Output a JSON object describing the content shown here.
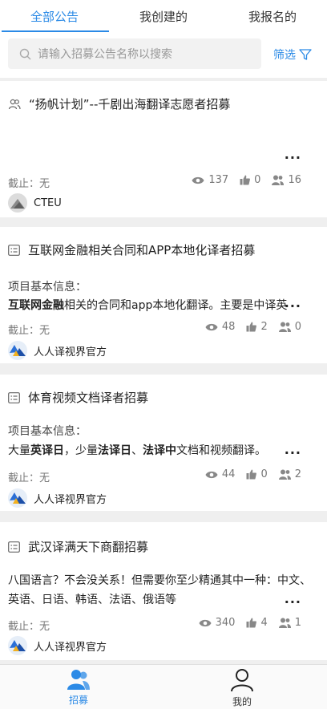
{
  "tabs": [
    "全部公告",
    "我创建的",
    "我报名的"
  ],
  "search": {
    "placeholder": "请输入招募公告名称以搜索",
    "filter_label": "筛选"
  },
  "cards": [
    {
      "title": "“扬帆计划”--千剧出海翻译志愿者招募",
      "deadline": "截止：无",
      "views": "137",
      "likes": "0",
      "applicants": "16",
      "publisher": "CTEU",
      "more": "..."
    },
    {
      "title": "互联网金融相关合同和APP本地化译者招募",
      "desc_label": "项目基本信息：",
      "desc_bold": "互联网金融",
      "desc_rest": "相关的合同和app本地化翻译。主要是中译英",
      "desc_ellipsis": "...",
      "deadline": "截止：无",
      "views": "48",
      "likes": "2",
      "applicants": "0",
      "publisher": "人人译视界官方"
    },
    {
      "title": "体育视频文档译者招募",
      "desc_label": "项目基本信息：",
      "desc_p1": "大量",
      "desc_b1": "英译日",
      "desc_p2": "，少量",
      "desc_b2": "法译日",
      "desc_p3": "、",
      "desc_b3": "法译中",
      "desc_p4": "文档和视频翻译。",
      "more": "...",
      "deadline": "截止：无",
      "views": "44",
      "likes": "0",
      "applicants": "2",
      "publisher": "人人译视界官方"
    },
    {
      "title": "武汉译满天下商翻招募",
      "desc_line1": "八国语言？不会没关系！但需要你至少精通其中一种：中文、",
      "desc_line2": "英语、日语、韩语、法语、俄语等",
      "more": "...",
      "deadline": "截止：无",
      "views": "340",
      "likes": "4",
      "applicants": "1",
      "publisher": "人人译视界官方"
    }
  ],
  "bottom_nav": {
    "recruit": "招募",
    "mine": "我的"
  },
  "colors": {
    "accent": "#2b8ae6"
  }
}
